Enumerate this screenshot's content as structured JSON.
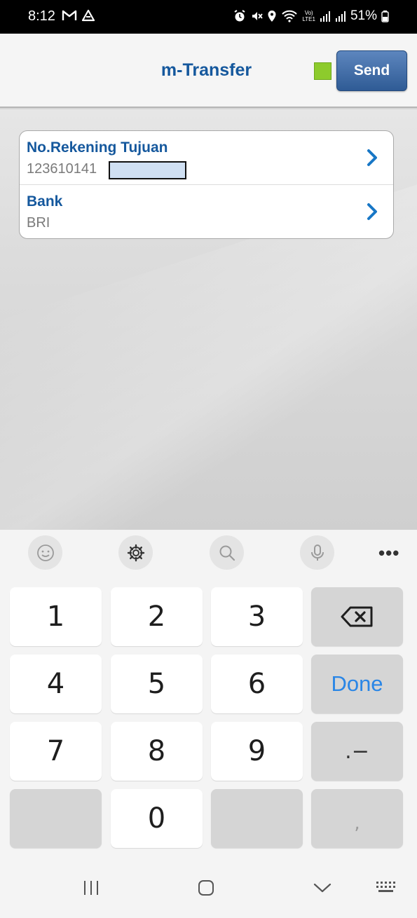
{
  "status_bar": {
    "time": "8:12",
    "battery": "51%",
    "network_badge_top": "Vo)",
    "network_badge_bottom": "LTE1"
  },
  "header": {
    "title": "m-Transfer",
    "send_label": "Send",
    "status_color": "#8dcb2c"
  },
  "form": {
    "rows": [
      {
        "label": "No.Rekening Tujuan",
        "value": "123610141"
      },
      {
        "label": "Bank",
        "value": "BRI"
      }
    ]
  },
  "keyboard": {
    "toolbar_icons": [
      "emoji-icon",
      "settings-icon",
      "search-icon",
      "microphone-icon",
      "more-icon"
    ],
    "more_label": "•••",
    "keys": {
      "k1": "1",
      "k2": "2",
      "k3": "3",
      "k4": "4",
      "k5": "5",
      "k6": "6",
      "k7": "7",
      "k8": "8",
      "k9": "9",
      "k0": "0",
      "done": "Done",
      "dot_minus": ".−",
      "comma": ","
    }
  },
  "nav_bar": {
    "icons": [
      "recent-apps-icon",
      "home-icon",
      "back-icon",
      "keyboard-hide-icon"
    ]
  }
}
